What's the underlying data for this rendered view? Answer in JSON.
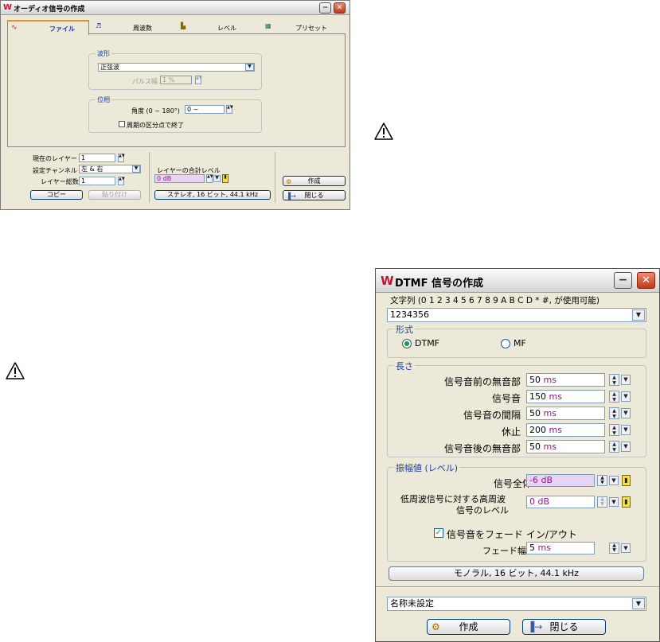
{
  "warning_icons": [
    "warning-icon",
    "warning-icon"
  ],
  "audio_dialog": {
    "title": "オーディオ信号の作成",
    "tabs": [
      {
        "label": "ファイル",
        "icon": "waveform-icon"
      },
      {
        "label": "周波数",
        "icon": "frequency-icon"
      },
      {
        "label": "レベル",
        "icon": "level-icon"
      },
      {
        "label": "プリセット",
        "icon": "preset-icon"
      }
    ],
    "waveform_group": {
      "label": "波形",
      "value": "正弦波",
      "pulse_label": "パルス幅",
      "pulse_value": "1 %"
    },
    "phase_group": {
      "label": "位相",
      "angle_label": "角度 (0 ~ 180°)",
      "angle_value": "0 ~",
      "checkbox_label": "周期の区分点で終了"
    },
    "bottom": {
      "current_layer_label": "現在のレイヤー",
      "current_layer_value": "1",
      "channel_label": "設定チャンネル",
      "channel_value": "左 & 右",
      "layer_total_label": "レイヤー総数",
      "layer_total_value": "1",
      "copy": "コピー",
      "paste": "貼り付け",
      "sum_level_label": "レイヤーの合計レベル",
      "sum_level_value": "0 dB",
      "format_button": "ステレオ, 16 ビット, 44.1 kHz",
      "create": "作成",
      "close": "閉じる"
    }
  },
  "dtmf_dialog": {
    "title": "DTMF 信号の作成",
    "string_label": "文字列 (0 1 2 3 4 5 6 7 8 9 A B C D * #, が使用可能)",
    "string_value": "1234356",
    "format": {
      "label": "形式",
      "options": [
        "DTMF",
        "MF"
      ],
      "selected": "DTMF"
    },
    "length": {
      "label": "長さ",
      "fields": [
        {
          "label": "信号音前の無音部",
          "value": "50",
          "unit": "ms"
        },
        {
          "label": "信号音",
          "value": "150",
          "unit": "ms"
        },
        {
          "label": "信号音の間隔",
          "value": "50",
          "unit": "ms"
        },
        {
          "label": "休止",
          "value": "200",
          "unit": "ms"
        },
        {
          "label": "信号音後の無音部",
          "value": "50",
          "unit": "ms"
        }
      ]
    },
    "amplitude": {
      "label": "振幅値 (レベル)",
      "overall_label": "信号全体",
      "overall_value": "-6 dB",
      "hf_label_1": "低周波信号に対する高周波",
      "hf_label_2": "信号のレベル",
      "hf_value": "0 dB",
      "fade_checkbox": "信号音をフェード イン/アウト",
      "fade_checked": true,
      "fade_width_label": "フェード幅",
      "fade_width_value": "5",
      "fade_width_unit": "ms"
    },
    "format_button": "モノラル, 16 ビット, 44.1 kHz",
    "preset_value": "名称未設定",
    "create": "作成",
    "close": "閉じる"
  },
  "colors": {
    "accent": "#1a3ea6",
    "level_bg": "#e6d4f2",
    "tab_active": "#f08a2e",
    "close_btn": "#c0391b"
  }
}
